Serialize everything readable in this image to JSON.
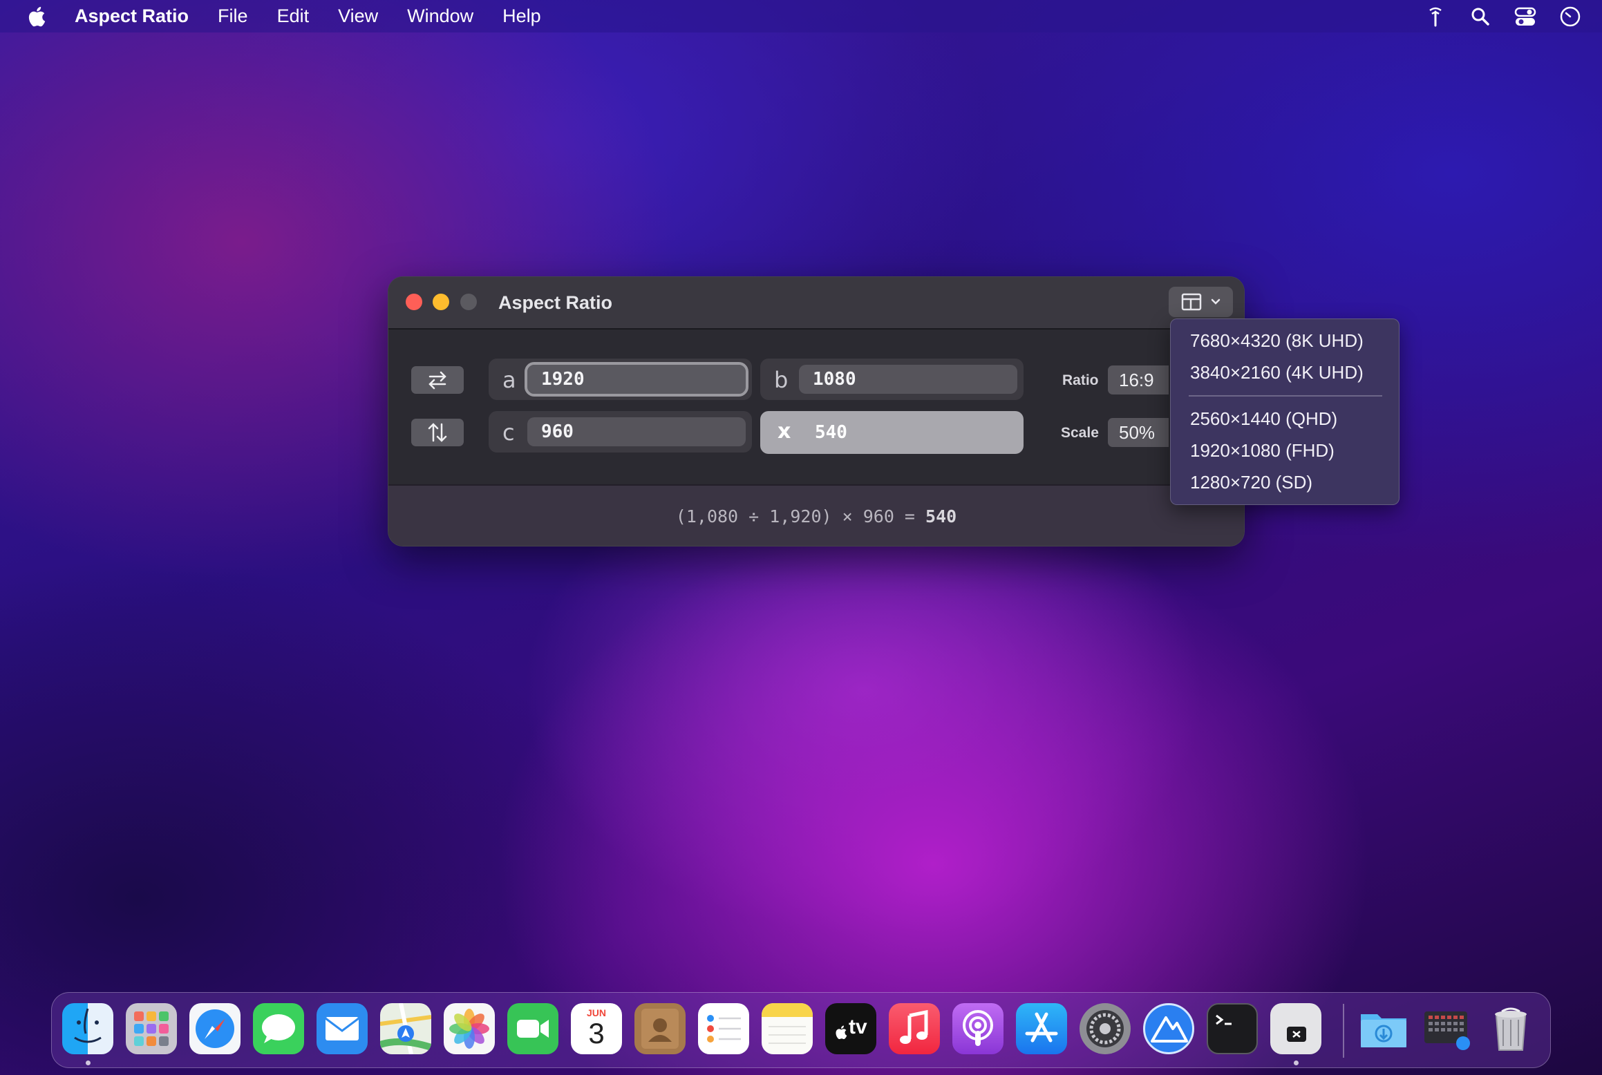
{
  "menubar": {
    "app_name": "Aspect Ratio",
    "items": [
      "File",
      "Edit",
      "View",
      "Window",
      "Help"
    ]
  },
  "window": {
    "title": "Aspect Ratio",
    "fields": {
      "a": {
        "label": "a",
        "value": "1920"
      },
      "b": {
        "label": "b",
        "value": "1080"
      },
      "c": {
        "label": "c",
        "value": "960"
      },
      "x": {
        "label": "x",
        "value": "540"
      }
    },
    "ratio": {
      "label": "Ratio",
      "value": "16:9"
    },
    "scale": {
      "label": "Scale",
      "value": "50%"
    },
    "formula": {
      "expr": "(1,080 ÷ 1,920) × 960 =",
      "result": "540"
    }
  },
  "presets": {
    "items": [
      "7680×4320 (8K UHD)",
      "3840×2160 (4K UHD)",
      "2560×1440 (QHD)",
      "1920×1080 (FHD)",
      "1280×720 (SD)"
    ]
  },
  "dock": {
    "apps": [
      "finder",
      "launchpad",
      "safari",
      "messages",
      "mail",
      "maps",
      "photos",
      "facetime",
      "calendar",
      "contacts",
      "reminders",
      "notes",
      "apple-tv",
      "music",
      "podcasts",
      "app-store",
      "system-settings",
      "aspect-ratio",
      "terminal",
      "simulator-app",
      "downloads-folder",
      "screenshot-grid",
      "trash"
    ],
    "calendar_month": "JUN",
    "calendar_day": "3",
    "tv_label": "tv"
  }
}
